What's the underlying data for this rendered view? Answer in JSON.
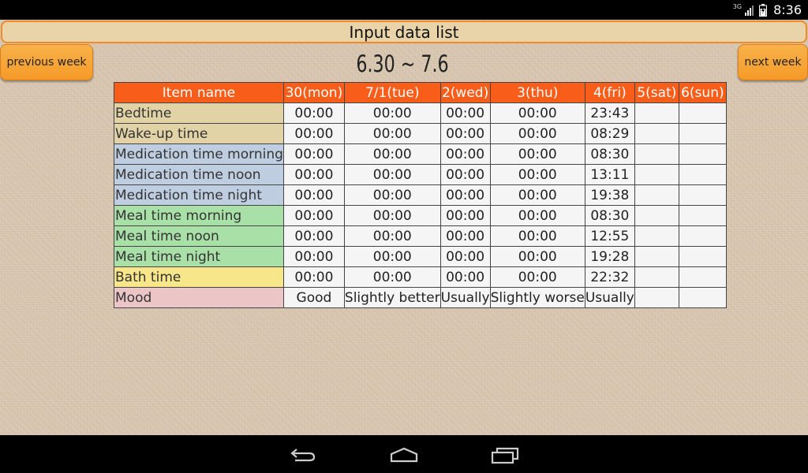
{
  "status_bar": {
    "network": "3G",
    "time": "8:36"
  },
  "title": "Input data list",
  "buttons": {
    "previous_week": "previous week",
    "next_week": "next week"
  },
  "date_range": "6.30 ~ 7.6",
  "table": {
    "headers": [
      "Item name",
      "30(mon)",
      "7/1(tue)",
      "2(wed)",
      "3(thu)",
      "4(fri)",
      "5(sat)",
      "6(sun)"
    ],
    "header_color": "#f95d1a",
    "rows": [
      {
        "label": "Bedtime",
        "color": "#e2d3a6",
        "values": [
          "00:00",
          "00:00",
          "00:00",
          "00:00",
          "23:43",
          "",
          ""
        ]
      },
      {
        "label": "Wake-up time",
        "color": "#e2d3a6",
        "values": [
          "00:00",
          "00:00",
          "00:00",
          "00:00",
          "08:29",
          "",
          ""
        ]
      },
      {
        "label": "Medication time morning",
        "color": "#bfcde0",
        "values": [
          "00:00",
          "00:00",
          "00:00",
          "00:00",
          "08:30",
          "",
          ""
        ]
      },
      {
        "label": "Medication time noon",
        "color": "#bfcde0",
        "values": [
          "00:00",
          "00:00",
          "00:00",
          "00:00",
          "13:11",
          "",
          ""
        ]
      },
      {
        "label": "Medication time night",
        "color": "#bfcde0",
        "values": [
          "00:00",
          "00:00",
          "00:00",
          "00:00",
          "19:38",
          "",
          ""
        ]
      },
      {
        "label": "Meal time morning",
        "color": "#a8e0a8",
        "values": [
          "00:00",
          "00:00",
          "00:00",
          "00:00",
          "08:30",
          "",
          ""
        ]
      },
      {
        "label": "Meal time noon",
        "color": "#a8e0a8",
        "values": [
          "00:00",
          "00:00",
          "00:00",
          "00:00",
          "12:55",
          "",
          ""
        ]
      },
      {
        "label": "Meal time night",
        "color": "#a8e0a8",
        "values": [
          "00:00",
          "00:00",
          "00:00",
          "00:00",
          "19:28",
          "",
          ""
        ]
      },
      {
        "label": "Bath time",
        "color": "#f7e68a",
        "values": [
          "00:00",
          "00:00",
          "00:00",
          "00:00",
          "22:32",
          "",
          ""
        ]
      },
      {
        "label": "Mood",
        "color": "#ecc6c6",
        "values": [
          "Good",
          "Slightly better",
          "Usually",
          "Slightly worse",
          "Usually",
          "",
          ""
        ]
      }
    ]
  },
  "nav": {
    "back_icon": "back-icon",
    "home_icon": "home-icon",
    "recent_icon": "recent-apps-icon"
  }
}
